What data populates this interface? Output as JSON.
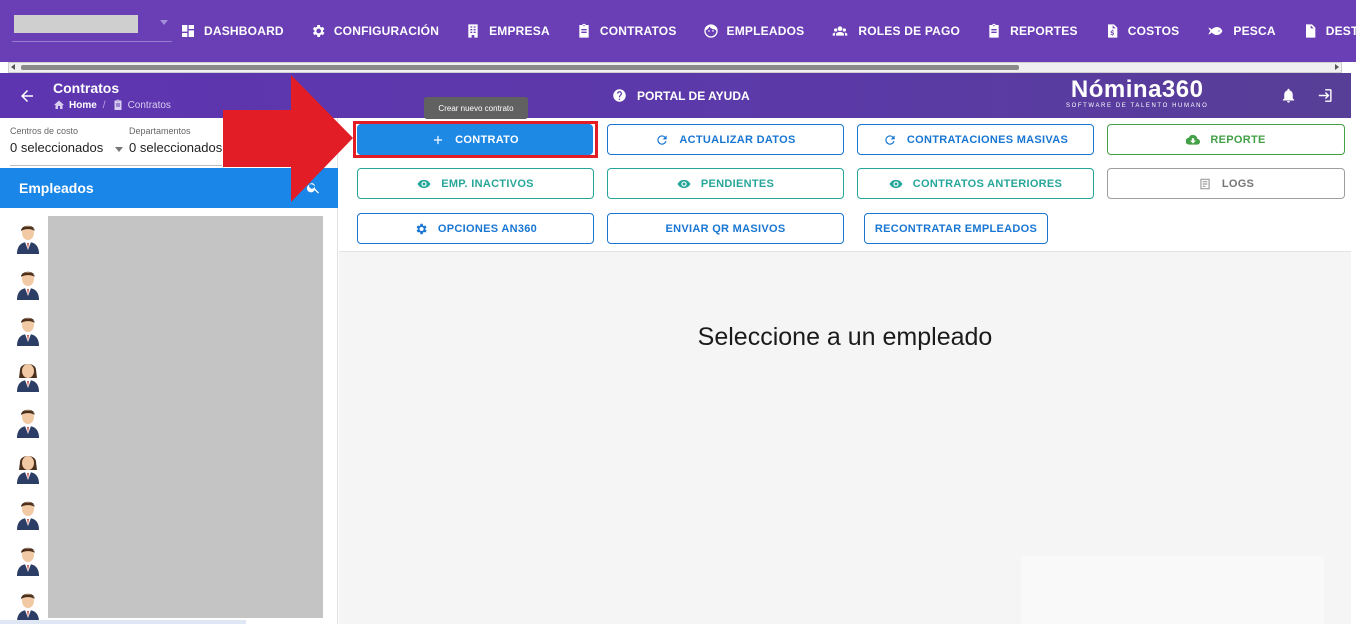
{
  "topnav": {
    "items": [
      {
        "label": "DASHBOARD",
        "icon": "dashboard-icon"
      },
      {
        "label": "CONFIGURACIÓN",
        "icon": "gear-icon"
      },
      {
        "label": "EMPRESA",
        "icon": "building-icon"
      },
      {
        "label": "CONTRATOS",
        "icon": "clipboard-icon"
      },
      {
        "label": "EMPLEADOS",
        "icon": "face-icon"
      },
      {
        "label": "ROLES DE PAGO",
        "icon": "people-icon"
      },
      {
        "label": "REPORTES",
        "icon": "clipboard-icon"
      },
      {
        "label": "COSTOS",
        "icon": "invoice-icon"
      },
      {
        "label": "PESCA",
        "icon": "fish-icon"
      },
      {
        "label": "DESTAJO",
        "icon": "document-icon"
      }
    ]
  },
  "header": {
    "title": "Contratos",
    "breadcrumb_home": "Home",
    "breadcrumb_separator": "/",
    "breadcrumb_current": "Contratos",
    "help_label": "PORTAL DE AYUDA",
    "logo_name": "Nómina360",
    "logo_tagline": "SOFTWARE DE TALENTO HUMANO"
  },
  "filters": {
    "cost_centers_label": "Centros de costo",
    "cost_centers_value": "0 seleccionados",
    "departments_label": "Departamentos",
    "departments_value": "0 seleccionados"
  },
  "employees": {
    "title": "Empleados",
    "avatars": [
      "male",
      "male",
      "male",
      "female",
      "male",
      "female",
      "male",
      "male",
      "male"
    ]
  },
  "actions": {
    "tooltip": "Crear nuevo contrato",
    "contrato": "CONTRATO",
    "actualizar": "ACTUALIZAR DATOS",
    "contrataciones": "CONTRATACIONES MASIVAS",
    "reporte": "REPORTE",
    "inactivos": "EMP. INACTIVOS",
    "pendientes": "PENDIENTES",
    "anteriores": "CONTRATOS ANTERIORES",
    "logs": "LOGS",
    "opciones": "OPCIONES AN360",
    "qr": "ENVIAR QR MASIVOS",
    "recontratar": "RECONTRATAR EMPLEADOS"
  },
  "main": {
    "placeholder": "Seleccione a un empleado"
  },
  "colors": {
    "nav_purple": "#6a3fb5",
    "primary_blue": "#1e88e5",
    "teal": "#26a69a",
    "green": "#43a047",
    "annotation_red": "#e21d26"
  }
}
